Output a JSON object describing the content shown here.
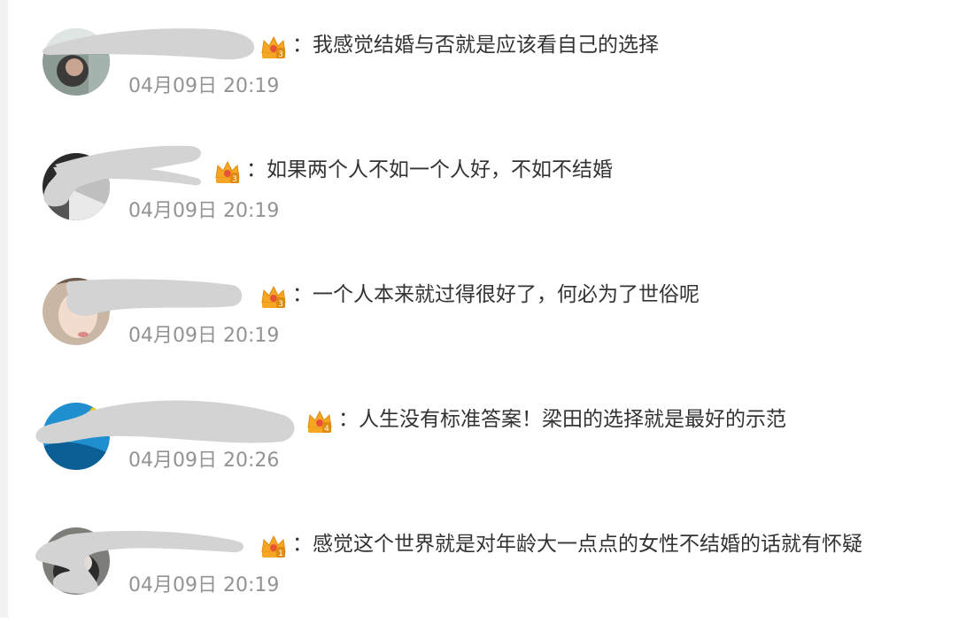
{
  "comments": [
    {
      "text": "：我感觉结婚与否就是应该看自己的选择",
      "time": "04月09日 20:19",
      "badge_level": "3",
      "badge_color": "#f5a623"
    },
    {
      "text": "：如果两个人不如一个人好，不如不结婚",
      "time": "04月09日 20:19",
      "badge_level": "3",
      "badge_color": "#f5a623"
    },
    {
      "text": "：一个人本来就过得很好了，何必为了世俗呢",
      "time": "04月09日 20:19",
      "badge_level": "3",
      "badge_color": "#f5a623"
    },
    {
      "text": "：人生没有标准答案！梁田的选择就是最好的示范",
      "time": "04月09日 20:26",
      "badge_level": "4",
      "badge_color": "#f5a623"
    },
    {
      "text": "：感觉这个世界就是对年龄大一点点的女性不结婚的话就有怀疑",
      "time": "04月09日 20:19",
      "badge_level": "1",
      "badge_color": "#f5a623"
    }
  ],
  "colors": {
    "timestamp": "#939393",
    "text": "#333333",
    "redaction": "#d3d3d3",
    "username": "#e8503a"
  }
}
